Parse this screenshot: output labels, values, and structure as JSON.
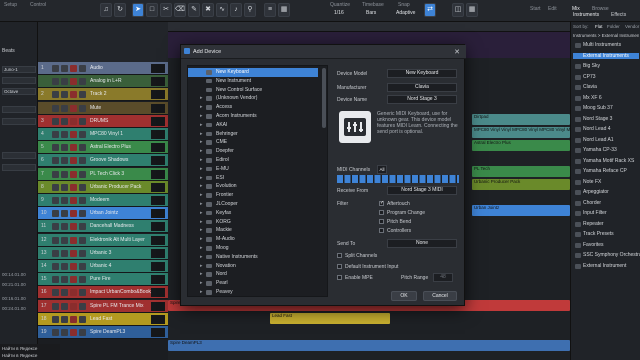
{
  "toolbar": {
    "setup_label": "Setup",
    "control_label": "Control",
    "quantize_label": "Quantize",
    "quantize_value": "1/16",
    "timebase_label": "Timebase",
    "timebase_value": "Bars",
    "snap_label": "Snap",
    "snap_value": "Adaptive",
    "start_label": "Start",
    "edit_label": "Edit",
    "mix_label": "Mix",
    "browse_label": "Browse",
    "instruments_tab": "Instruments",
    "effects_tab": "Effects"
  },
  "inspector": {
    "beats_label": "Beats",
    "preset_value": "Juno-1",
    "octave_label": "Octave",
    "times": [
      "00:14.01.00",
      "00:21.01.00",
      "00:16.01.00",
      "00:24.01.00"
    ]
  },
  "tracks": [
    {
      "num": "1",
      "name": "Audio",
      "color": "#5b6b8a"
    },
    {
      "num": "",
      "name": "Analog in L+R",
      "color": "#3a5f3a"
    },
    {
      "num": "2",
      "name": "Track 2",
      "color": "#8a7a2a"
    },
    {
      "num": "",
      "name": "Mute",
      "color": "#5a4c2a"
    },
    {
      "num": "3",
      "name": "DRUMS",
      "color": "#a03030"
    },
    {
      "num": "4",
      "name": "MPC80 Vinyl 1",
      "color": "#2f7f6f"
    },
    {
      "num": "5",
      "name": "Astral Electro Plus",
      "color": "#3a8a4a"
    },
    {
      "num": "6",
      "name": "Groove Shadows",
      "color": "#2f7f6f"
    },
    {
      "num": "7",
      "name": "PL Tech Click 3",
      "color": "#3a8a4a"
    },
    {
      "num": "8",
      "name": "Urbanic Producer Pack",
      "color": "#6a8a2a"
    },
    {
      "num": "9",
      "name": "Modeem",
      "color": "#2f7f6f"
    },
    {
      "num": "10",
      "name": "Urban Jointz",
      "color": "#3e83d6"
    },
    {
      "num": "11",
      "name": "Dancehall Madness",
      "color": "#2f7f6f"
    },
    {
      "num": "12",
      "name": "Elektronik Alt Multi Layer",
      "color": "#2f7f6f"
    },
    {
      "num": "13",
      "name": "Urbanic 3",
      "color": "#2f7f6f"
    },
    {
      "num": "14",
      "name": "Urbanic 4",
      "color": "#2f7f6f"
    },
    {
      "num": "15",
      "name": "Pure Fire",
      "color": "#2f7f6f"
    },
    {
      "num": "16",
      "name": "Impact UrbanCombo&Book_2",
      "color": "#a03030"
    },
    {
      "num": "17",
      "name": "Spire PL FM Trance Mix",
      "color": "#a03030"
    },
    {
      "num": "18",
      "name": "Lead Fast",
      "color": "#b39a20"
    },
    {
      "num": "19",
      "name": "Spire DeamPL3",
      "color": "#2f5f9a"
    }
  ],
  "arrange": {
    "clip_labels": {
      "dirtpad": "Dirtpad",
      "mpc80": "MPC80 Vinyl Vinyl MPC80 Vinyl MPC80 Vinyl MPC80",
      "astral": "Astral Electro Plus",
      "urbanic": "Urbanic Producer Pack",
      "pltech": "PL Tech",
      "urban_jointz": "Urban Jointz",
      "spire_trance": "Spire PL FM Trance MIX",
      "lead_fast": "Lead Fast",
      "spire_deam": "Spire DeamPL3"
    }
  },
  "browser": {
    "sort_label": "Sort by:",
    "sort_flat": "Flat",
    "sort_folder": "Folder",
    "sort_vendor": "Vendor",
    "path": "Instruments > External Instruments",
    "items": [
      "Multi Instruments",
      "External Instruments",
      "Big Sky",
      "CP73",
      "Clavia",
      "Mx XF 6",
      "Moog Sub 37",
      "Nord Stage 3",
      "Nord Lead 4",
      "Nord Lead A1",
      "Yamaha CP-33",
      "Yamaha Motif Rack XS",
      "Yamaha Reface CP",
      "Note FX",
      "Arpeggiator",
      "Chorder",
      "Input Filter",
      "Repeater",
      "Track Presets",
      "Favorites",
      "SSC Symphony Orchestra",
      "External Instrument"
    ],
    "selected_index": 1
  },
  "dialog": {
    "title": "Add Device",
    "close_glyph": "✕",
    "list": [
      {
        "label": "New Keyboard",
        "arrow": "",
        "selected": true
      },
      {
        "label": "New Instrument",
        "arrow": ""
      },
      {
        "label": "New Control Surface",
        "arrow": ""
      },
      {
        "label": "(Unknown Vendor)",
        "arrow": "▸"
      },
      {
        "label": "Access",
        "arrow": "▸"
      },
      {
        "label": "Acorn Instruments",
        "arrow": "▸"
      },
      {
        "label": "AKAI",
        "arrow": "▸"
      },
      {
        "label": "Behringer",
        "arrow": "▸"
      },
      {
        "label": "CME",
        "arrow": "▸"
      },
      {
        "label": "Doepfer",
        "arrow": "▸"
      },
      {
        "label": "Edirol",
        "arrow": "▸"
      },
      {
        "label": "E-MU",
        "arrow": "▸"
      },
      {
        "label": "ESI",
        "arrow": "▸"
      },
      {
        "label": "Evolution",
        "arrow": "▸"
      },
      {
        "label": "Frontier",
        "arrow": "▸"
      },
      {
        "label": "JLCooper",
        "arrow": "▸"
      },
      {
        "label": "Keyfax",
        "arrow": "▸"
      },
      {
        "label": "KORG",
        "arrow": "▸"
      },
      {
        "label": "Mackie",
        "arrow": "▸"
      },
      {
        "label": "M-Audio",
        "arrow": "▸"
      },
      {
        "label": "Moog",
        "arrow": "▸"
      },
      {
        "label": "Native Instruments",
        "arrow": "▸"
      },
      {
        "label": "Novation",
        "arrow": "▸"
      },
      {
        "label": "Nord",
        "arrow": "▸"
      },
      {
        "label": "Pearl",
        "arrow": "▸"
      },
      {
        "label": "Peavey",
        "arrow": "▸"
      }
    ],
    "device_model_label": "Device Model",
    "device_model_value": "New Keyboard",
    "manufacturer_label": "Manufacturer",
    "manufacturer_value": "Clavia",
    "device_name_label": "Device Name",
    "device_name_value": "Nord Stage 3",
    "description": "Generic MIDI Keyboard, use for unknown gear. This device model features MIDI Learn. Connecting the send port is optional.",
    "midi_channels_label": "MIDI Channels",
    "all_label": "All",
    "receive_from_label": "Receive From",
    "receive_from_value": "Nord Stage 3 MIDI",
    "filter_label": "Filter",
    "filters": [
      {
        "label": "Aftertouch",
        "checked": true
      },
      {
        "label": "Program Change",
        "checked": false
      },
      {
        "label": "Pitch Bend",
        "checked": false
      },
      {
        "label": "Controllers",
        "checked": false
      }
    ],
    "send_to_label": "Send To",
    "send_to_value": "None",
    "split_channels_label": "Split Channels",
    "default_instrument_label": "Default Instrument Input",
    "enable_mpe_label": "Enable MPE",
    "pitch_range_label": "Pitch Range",
    "pitch_range_value": "48",
    "ok_label": "OK",
    "cancel_label": "Cancel"
  },
  "taskbar": {
    "item1": "Найти в Яндексе",
    "item2": "Найти в Яндексе"
  }
}
